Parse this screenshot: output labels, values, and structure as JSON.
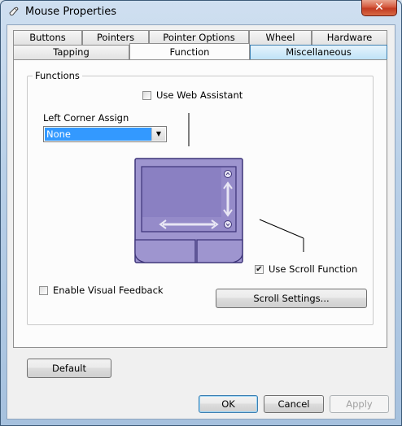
{
  "window": {
    "title": "Mouse Properties",
    "close_glyph": "✕"
  },
  "tabs_row1": [
    {
      "label": "Buttons"
    },
    {
      "label": "Pointers"
    },
    {
      "label": "Pointer Options"
    },
    {
      "label": "Wheel"
    },
    {
      "label": "Hardware"
    }
  ],
  "tabs_row2": [
    {
      "label": "Tapping"
    },
    {
      "label": "Function",
      "active": true
    },
    {
      "label": "Miscellaneous",
      "hover": true
    }
  ],
  "functions": {
    "group_label": "Functions",
    "use_web_assistant": {
      "label": "Use Web Assistant",
      "checked": false
    },
    "left_corner_assign": {
      "label": "Left Corner Assign",
      "selected": "None"
    },
    "use_scroll_function": {
      "label": "Use Scroll Function",
      "checked": true
    },
    "enable_visual_feedback": {
      "label": "Enable Visual Feedback",
      "checked": false
    },
    "scroll_settings_label": "Scroll Settings..."
  },
  "touchpad": {
    "colors": {
      "body": "#9e95cf",
      "surface": "#8a80c2",
      "border": "#3d3479"
    },
    "icons": [
      "scroll-up-icon",
      "scroll-down-icon",
      "vertical-scroll-arrow-icon",
      "horizontal-scroll-arrow-icon"
    ]
  },
  "footer": {
    "default_label": "Default",
    "ok_label": "OK",
    "cancel_label": "Cancel",
    "apply_label": "Apply"
  },
  "check_glyph": "✔",
  "dropdown_glyph": "▼"
}
